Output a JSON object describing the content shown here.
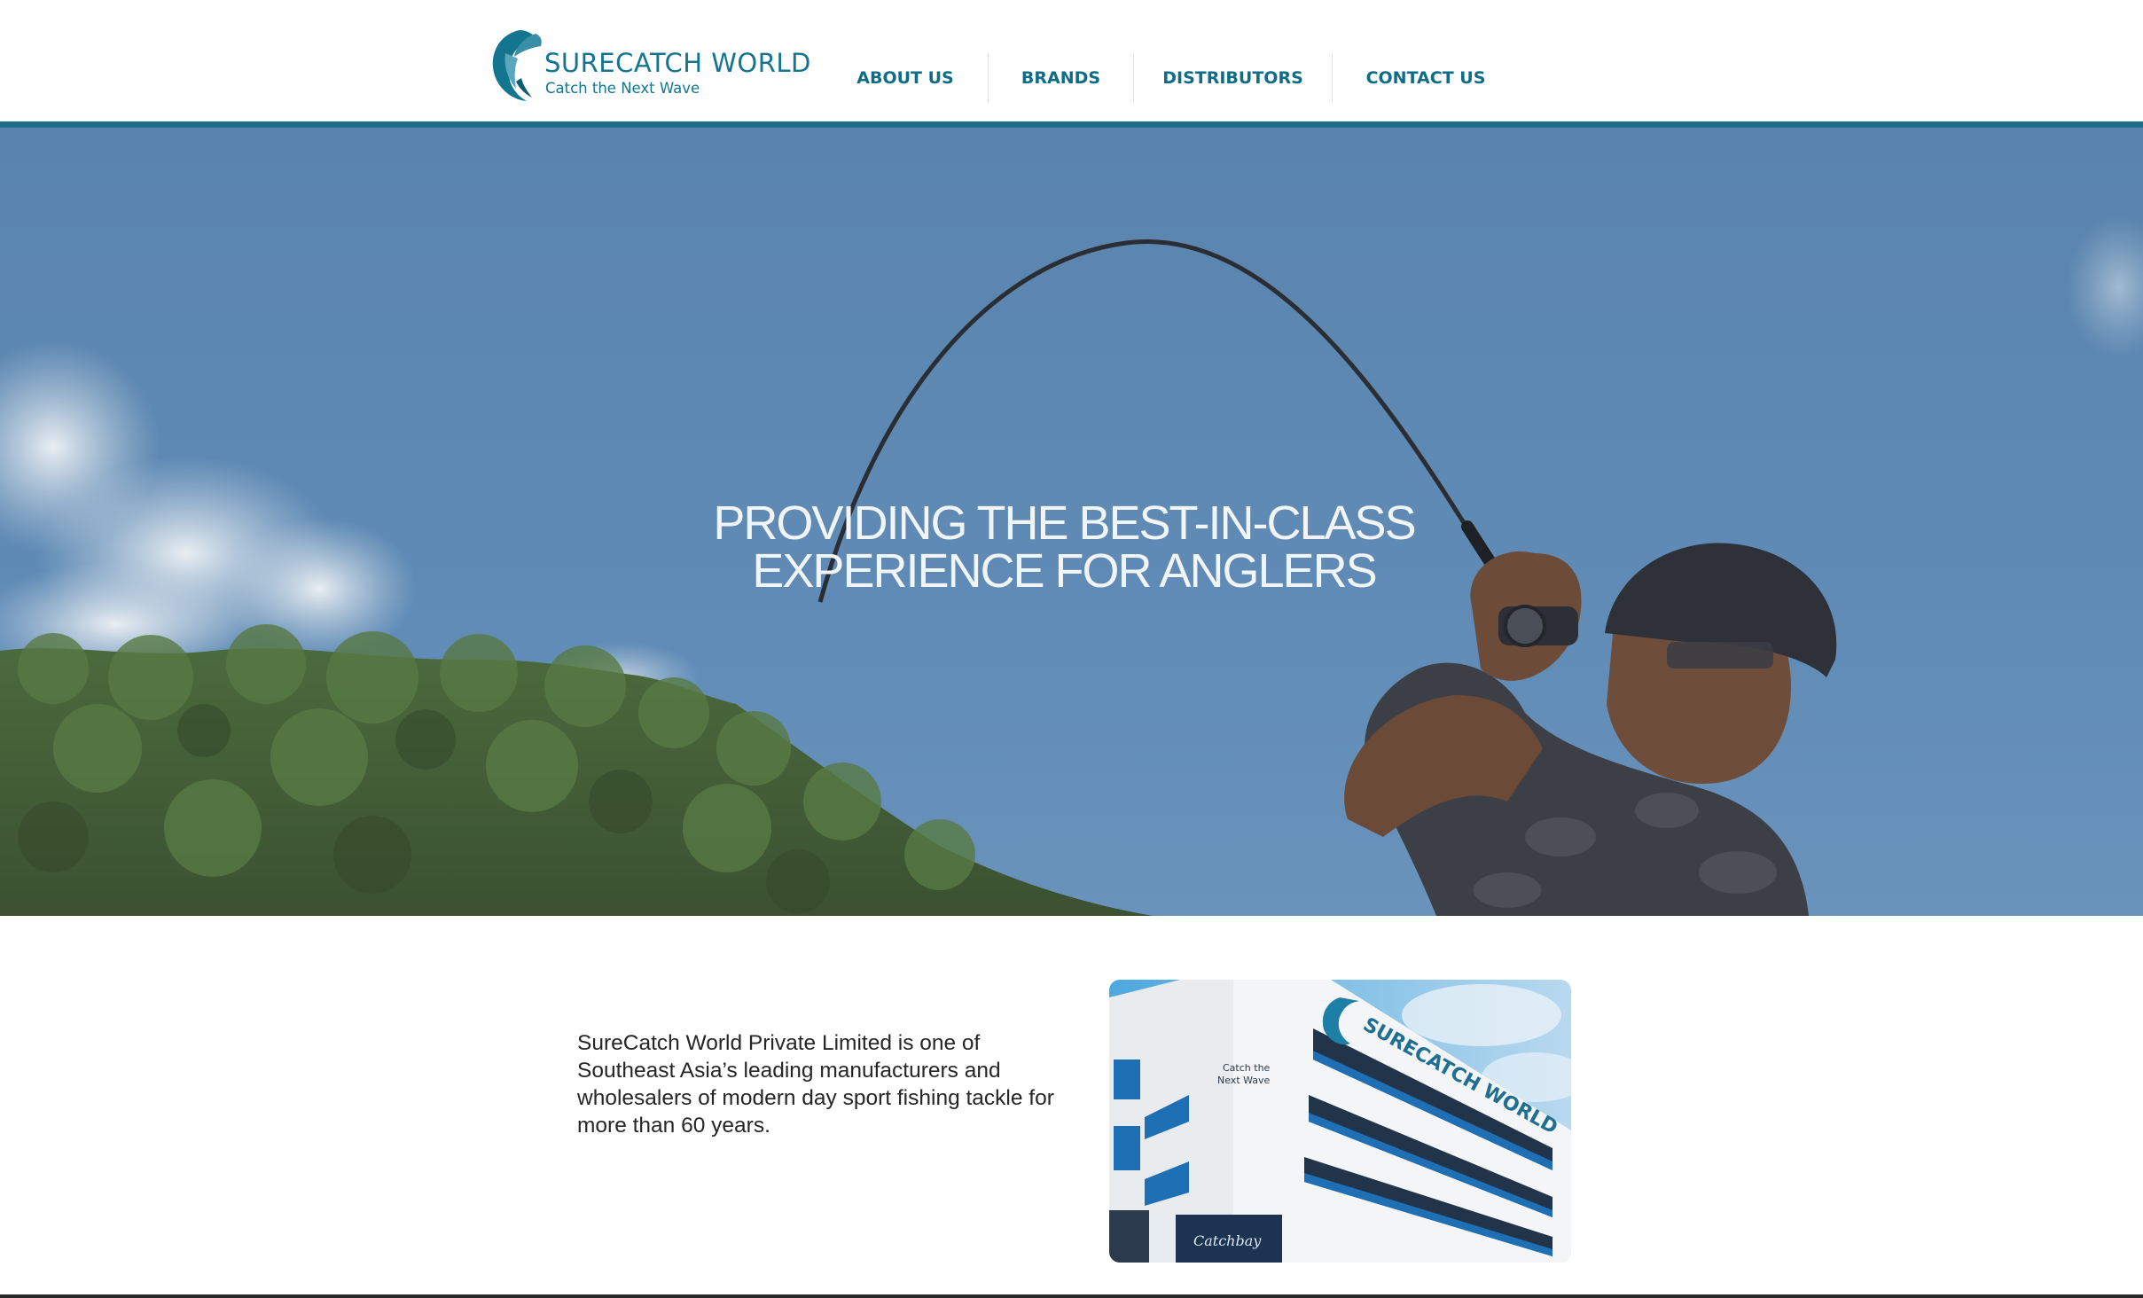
{
  "brand": {
    "name": "SURECATCH WORLD",
    "tagline": "Catch the Next Wave",
    "color": "#137590"
  },
  "nav": {
    "items": [
      {
        "label": "ABOUT US"
      },
      {
        "label": "BRANDS"
      },
      {
        "label": "DISTRIBUTORS"
      },
      {
        "label": "CONTACT US"
      }
    ]
  },
  "hero": {
    "title_line1": "PROVIDING THE BEST-IN-CLASS",
    "title_line2": "EXPERIENCE FOR ANGLERS"
  },
  "about": {
    "text": "SureCatch World Private Limited is one of Southeast Asia’s leading manufacturers and wholesalers of modern day sport fishing tackle for more than 60 years.",
    "image": {
      "signage_text": "SURECATCH WORLD",
      "wall_text_line1": "Catch the",
      "wall_text_line2": "Next Wave",
      "sign_text": "Catchbay"
    }
  }
}
